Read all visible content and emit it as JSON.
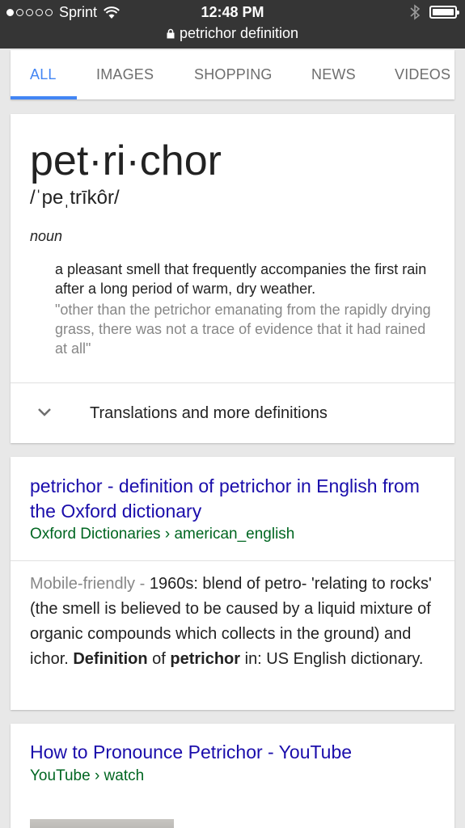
{
  "status_bar": {
    "carrier": "Sprint",
    "time": "12:48 PM",
    "url": "petrichor definition"
  },
  "tabs": [
    {
      "label": "ALL",
      "active": true
    },
    {
      "label": "IMAGES",
      "active": false
    },
    {
      "label": "SHOPPING",
      "active": false
    },
    {
      "label": "NEWS",
      "active": false
    },
    {
      "label": "VIDEOS",
      "active": false
    }
  ],
  "dictionary": {
    "word": "pet·ri·chor",
    "phonetic": "/ˈpeˌtrīkôr/",
    "part_of_speech": "noun",
    "definition": "a pleasant smell that frequently accompanies the first rain after a long period of warm, dry weather.",
    "example": "\"other than the petrichor emanating from the rapidly drying grass, there was not a trace of evidence that it had rained at all\"",
    "more_label": "Translations and more definitions"
  },
  "results": [
    {
      "title": "petrichor - definition of petrichor in English from the Oxford dictionary",
      "url": "Oxford Dictionaries › american_english",
      "mobile_label": "Mobile-friendly -",
      "snippet_a": " 1960s: blend of petro- 'relating to rocks' (the smell is believed to be caused by a liquid mixture of organic compounds which collects in the ground) and ichor. ",
      "snippet_b1": "Definition",
      "snippet_c": " of ",
      "snippet_b2": "petrichor",
      "snippet_d": " in: US English dictionary."
    },
    {
      "title": "How to Pronounce Petrichor - YouTube",
      "url": "YouTube › watch"
    }
  ],
  "colors": {
    "accent": "#4285f4",
    "link": "#1a0dab",
    "url": "#006621",
    "status_bar": "#353535"
  }
}
